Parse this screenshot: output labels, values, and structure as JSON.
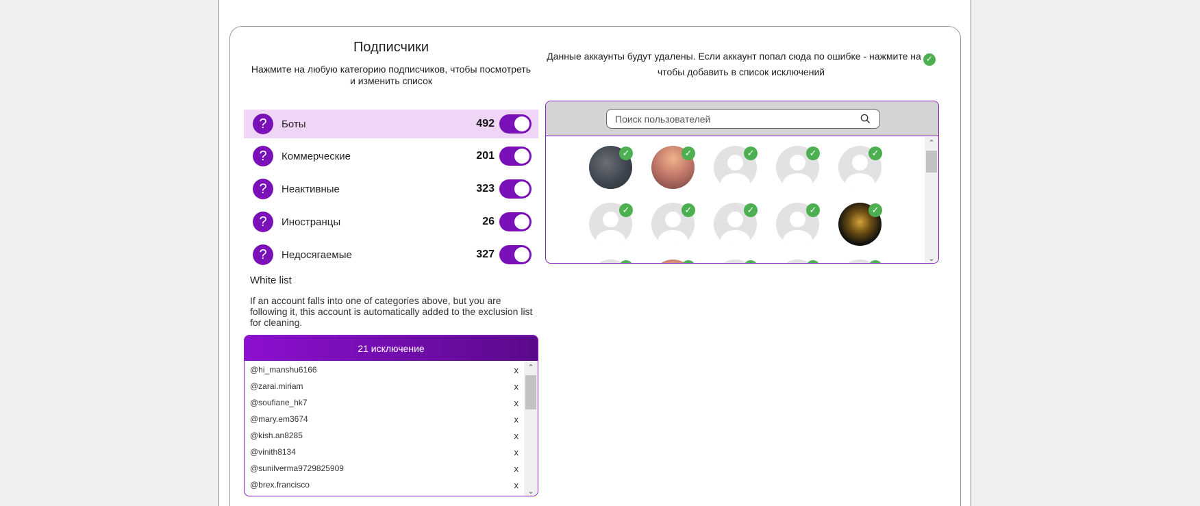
{
  "followers": {
    "title": "Подписчики",
    "subtitle": "Нажмите на любую категорию подписчиков, чтобы посмотреть и изменить список",
    "categories": [
      {
        "label": "Боты",
        "count": "492"
      },
      {
        "label": "Коммерческие",
        "count": "201"
      },
      {
        "label": "Неактивные",
        "count": "323"
      },
      {
        "label": "Иностранцы",
        "count": "26"
      },
      {
        "label": "Недосягаемые",
        "count": "327"
      }
    ]
  },
  "whitelist": {
    "title": "White list",
    "description": "If an account falls into one of categories above, but you are following it, this account is automatically added to the exclusion list for cleaning.",
    "header": "21 исключение",
    "items": [
      "@hi_manshu6166",
      "@zarai.miriam",
      "@soufiane_hk7",
      "@mary.em3674",
      "@kish.an8285",
      "@vinith8134",
      "@sunilverma9729825909",
      "@brex.francisco"
    ],
    "remove_label": "x"
  },
  "deletion": {
    "note_line1": "Данные аккаунты будут удалены. Если аккаунт попал сюда по ошибке - нажмите на",
    "note_line2": "чтобы добавить в список исключений",
    "search_placeholder": "Поиск пользователей"
  },
  "icons": {
    "help": "question-icon",
    "check": "check-icon",
    "search": "search-icon",
    "remove": "close-icon"
  },
  "colors": {
    "accent": "#7a11b8",
    "active_bg": "#efd6f6",
    "check": "#4caf50"
  }
}
